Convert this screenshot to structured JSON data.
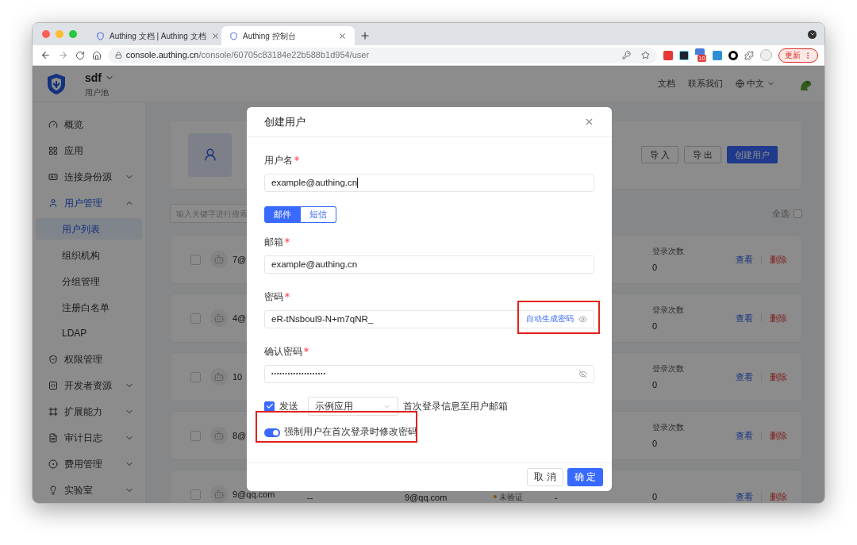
{
  "browser": {
    "tabs": [
      {
        "title": "Authing 文档 | Authing 文档",
        "selected": false
      },
      {
        "title": "Authing 控制台",
        "selected": true
      }
    ],
    "url_host": "console.authing.cn",
    "url_path": "/console/60705c83184e22b588b1d954/user",
    "extension_badge": "10",
    "update_button": "更新"
  },
  "header": {
    "pool_name": "sdf",
    "pool_label": "用户池",
    "links": [
      "文档",
      "联系我们"
    ],
    "language": "中文"
  },
  "sidebar": {
    "items": [
      {
        "label": "概览",
        "kind": "link",
        "active": false
      },
      {
        "label": "应用",
        "kind": "link",
        "active": false
      },
      {
        "label": "连接身份源",
        "kind": "group",
        "active": false,
        "expanded": false
      },
      {
        "label": "用户管理",
        "kind": "group",
        "active": true,
        "expanded": true,
        "children": [
          {
            "label": "用户列表",
            "selected": true
          },
          {
            "label": "组织机构",
            "selected": false
          },
          {
            "label": "分组管理",
            "selected": false
          },
          {
            "label": "注册白名单",
            "selected": false
          },
          {
            "label": "LDAP",
            "selected": false
          }
        ]
      },
      {
        "label": "权限管理",
        "kind": "link",
        "active": false
      },
      {
        "label": "开发者资源",
        "kind": "group",
        "active": false,
        "expanded": false
      },
      {
        "label": "扩展能力",
        "kind": "group",
        "active": false,
        "expanded": false
      },
      {
        "label": "审计日志",
        "kind": "group",
        "active": false,
        "expanded": false
      },
      {
        "label": "费用管理",
        "kind": "group",
        "active": false,
        "expanded": false
      },
      {
        "label": "实验室",
        "kind": "group",
        "active": false,
        "expanded": false
      }
    ]
  },
  "toolbar": {
    "buttons": [
      "导 入",
      "导 出"
    ],
    "primary": "创建用户"
  },
  "search": {
    "placeholder": "输入关键字进行搜索"
  },
  "select_all": {
    "label": "全选",
    "checked": false
  },
  "users": [
    {
      "email": "7@",
      "checked": false,
      "login_label": "登录次数",
      "login_count": "0",
      "actions": [
        "查看",
        "删除"
      ]
    },
    {
      "email": "4@",
      "checked": false,
      "login_label": "登录次数",
      "login_count": "0",
      "actions": [
        "查看",
        "删除"
      ]
    },
    {
      "email": "10",
      "checked": false,
      "login_label": "登录次数",
      "login_count": "0",
      "actions": [
        "查看",
        "删除"
      ]
    },
    {
      "email": "8@",
      "checked": false,
      "login_label": "登录次数",
      "login_count": "0",
      "actions": [
        "查看",
        "删除"
      ]
    },
    {
      "email": "9@qq.com",
      "checked": false,
      "phone": "--",
      "email_2": "9@qq.com",
      "status": "未验证",
      "extra": "-",
      "login_count": "0",
      "actions": [
        "查看",
        "删除"
      ]
    }
  ],
  "dialog": {
    "title": "创建用户",
    "username": {
      "label": "用户名",
      "required": true,
      "value": "example@authing.cn"
    },
    "channel_tabs": [
      {
        "label": "邮件",
        "selected": true
      },
      {
        "label": "短信",
        "selected": false
      }
    ],
    "email": {
      "label": "邮箱",
      "required": true,
      "value": "example@authing.cn"
    },
    "password": {
      "label": "密码",
      "required": true,
      "value": "eR-tNsboul9-N+m7qNR_",
      "generate_link": "自动生成密码"
    },
    "confirm_password": {
      "label": "确认密码",
      "required": true,
      "value": "••••••••••••••••••••"
    },
    "send": {
      "checked": true,
      "label": "发送",
      "app": "示例应用",
      "suffix": "首次登录信息至用户邮箱"
    },
    "force_reset": {
      "on": true,
      "label": "强制用户在首次登录时修改密码"
    },
    "cancel": "取 消",
    "ok": "确 定"
  }
}
